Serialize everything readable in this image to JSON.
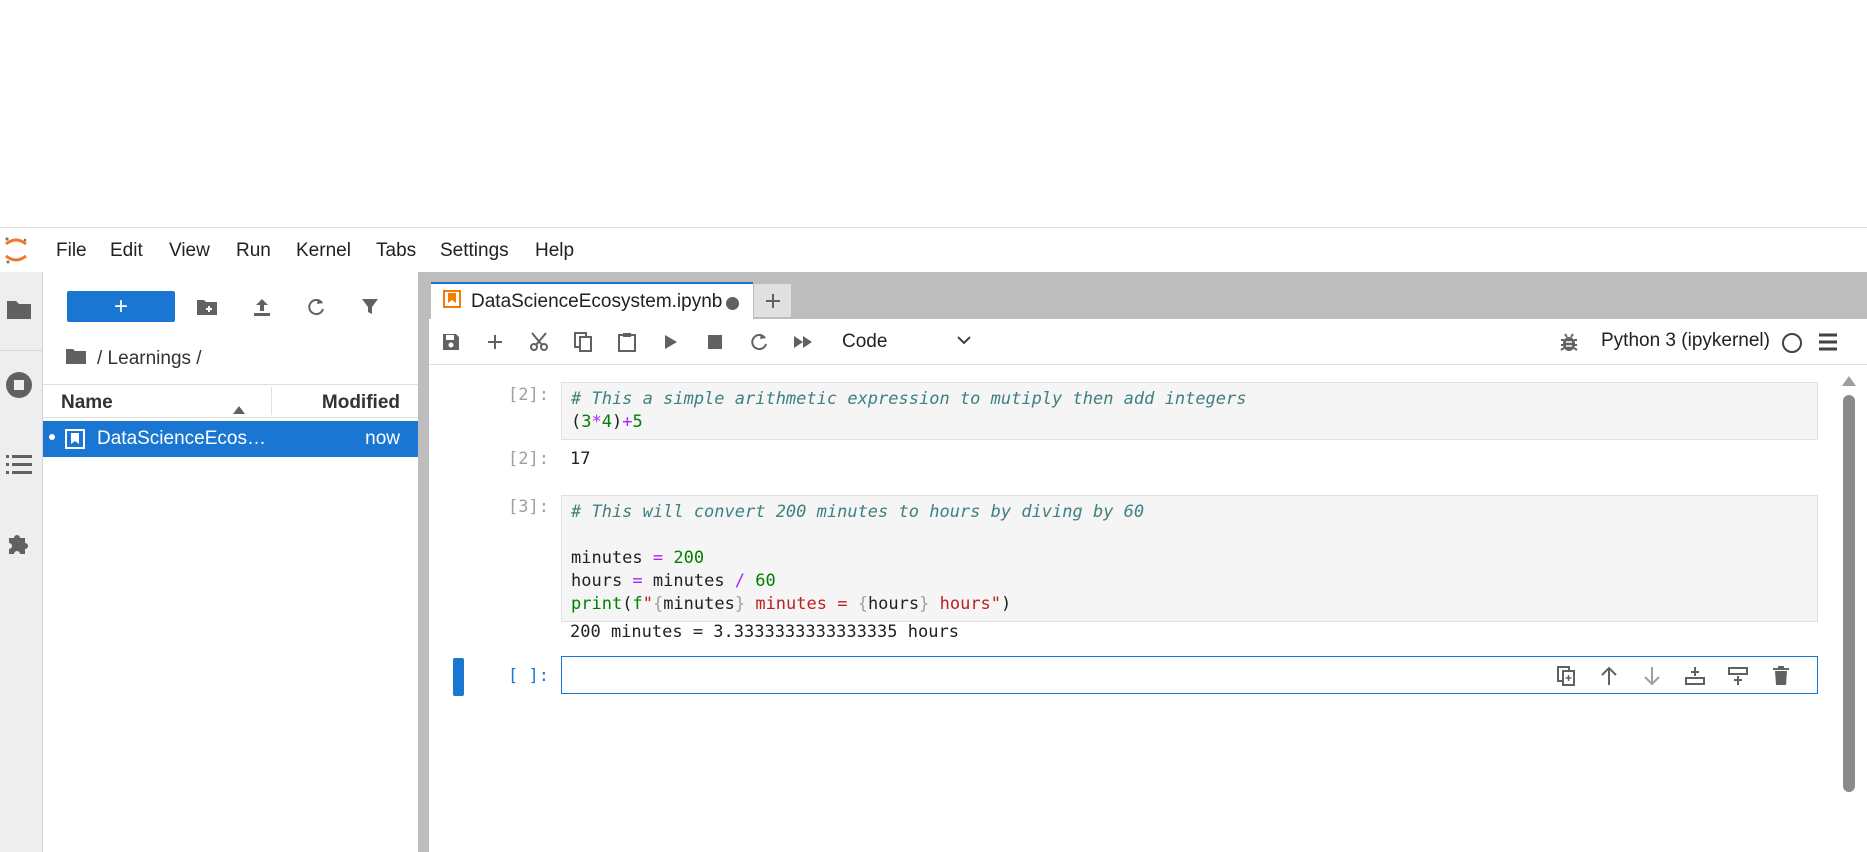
{
  "menu": {
    "items": [
      "File",
      "Edit",
      "View",
      "Run",
      "Kernel",
      "Tabs",
      "Settings",
      "Help"
    ]
  },
  "colors": {
    "accent": "#1976d2",
    "logo": "#f37726",
    "tab_icon": "#f57c00"
  },
  "filebrowser": {
    "new_button": "+",
    "breadcrumb": "/ Learnings /",
    "col_name": "Name",
    "col_modified": "Modified",
    "files": [
      {
        "name": "DataScienceEcosy...",
        "modified": "now"
      }
    ]
  },
  "tabs": [
    {
      "label": "DataScienceEcosystem.ipynb"
    }
  ],
  "toolbar": {
    "cell_type": "Code",
    "kernel": "Python 3 (ipykernel)"
  },
  "cells": [
    {
      "prompt_in": "[2]:",
      "source": [
        "# This a simple arithmetic expression to mutiply then add integers",
        "(3*4)+5"
      ],
      "prompt_out": "[2]:",
      "output": "17"
    },
    {
      "prompt_in": "[3]:",
      "source": [
        "# This will convert 200 minutes to hours by diving by 60",
        "",
        "minutes = 200",
        "hours = minutes / 60",
        "print(f\"{minutes} minutes = {hours} hours\")"
      ],
      "output": "200 minutes = 3.3333333333333335 hours"
    },
    {
      "prompt_in": "[ ]:"
    }
  ]
}
